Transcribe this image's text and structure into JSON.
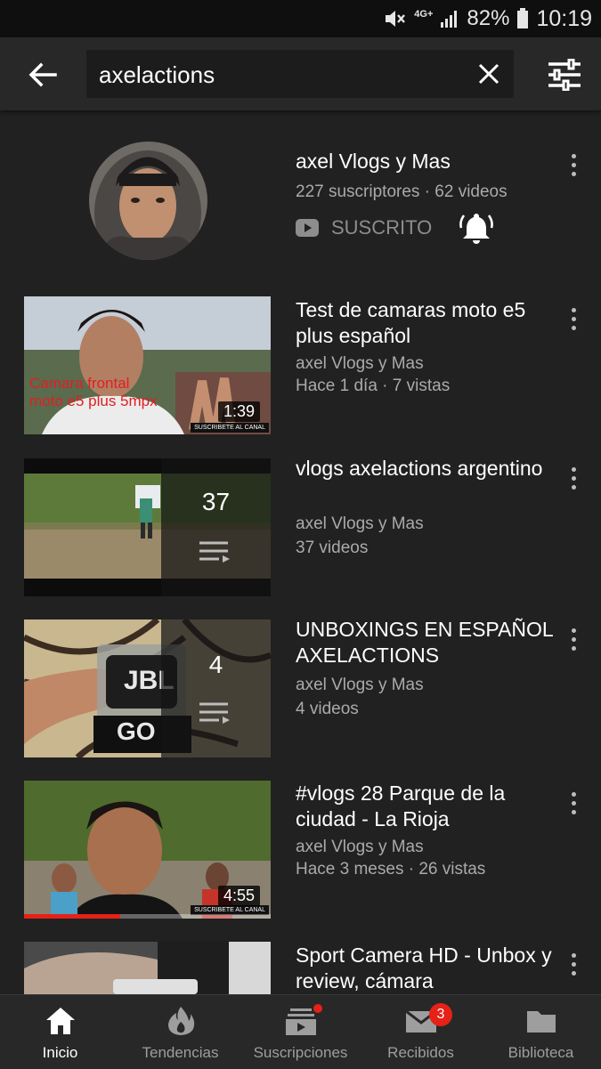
{
  "status_bar": {
    "network": "4G+",
    "battery": "82%",
    "time": "10:19"
  },
  "search": {
    "query": "axelactions"
  },
  "channel": {
    "name": "axel Vlogs y Mas",
    "meta": "227 suscriptores · 62 videos",
    "subscribed_label": "SUSCRITO"
  },
  "results": [
    {
      "title": "Test de camaras moto e5 plus español",
      "channel": "axel Vlogs y Mas",
      "meta": "Hace 1 día · 7 vistas",
      "duration": "1:39",
      "thumb_text": "Camara frontal moto e5 plus 5mpx",
      "thumb_banner": "SUSCRIBETE AL CANAL"
    },
    {
      "title": "vlogs axelactions argentino",
      "channel": "axel Vlogs y Mas",
      "meta": "37 videos",
      "playlist_count": "37"
    },
    {
      "title": "UNBOXINGS EN ESPAÑOL AXELACTIONS",
      "channel": "axel Vlogs y Mas",
      "meta": "4 videos",
      "playlist_count": "4",
      "thumb_brand": "JBL",
      "thumb_word": "GO"
    },
    {
      "title": "#vlogs 28 Parque de la ciudad - La Rioja",
      "channel": "axel Vlogs y Mas",
      "meta": "Hace 3 meses · 26 vistas",
      "duration": "4:55",
      "thumb_banner": "SUSCRIBETE AL CANAL",
      "watch_progress": 0.39
    },
    {
      "title": "Sport Camera HD - Unbox y review, cámara"
    }
  ],
  "bottom_nav": [
    {
      "label": "Inicio",
      "icon": "home-icon",
      "active": true
    },
    {
      "label": "Tendencias",
      "icon": "flame-icon"
    },
    {
      "label": "Suscripciones",
      "icon": "subscriptions-icon"
    },
    {
      "label": "Recibidos",
      "icon": "mail-icon",
      "badge": "3"
    },
    {
      "label": "Biblioteca",
      "icon": "folder-icon"
    }
  ],
  "colors": {
    "background": "#212121",
    "bar": "#282828",
    "accent_red": "#e62117",
    "secondary_text": "#aaaaaa"
  }
}
